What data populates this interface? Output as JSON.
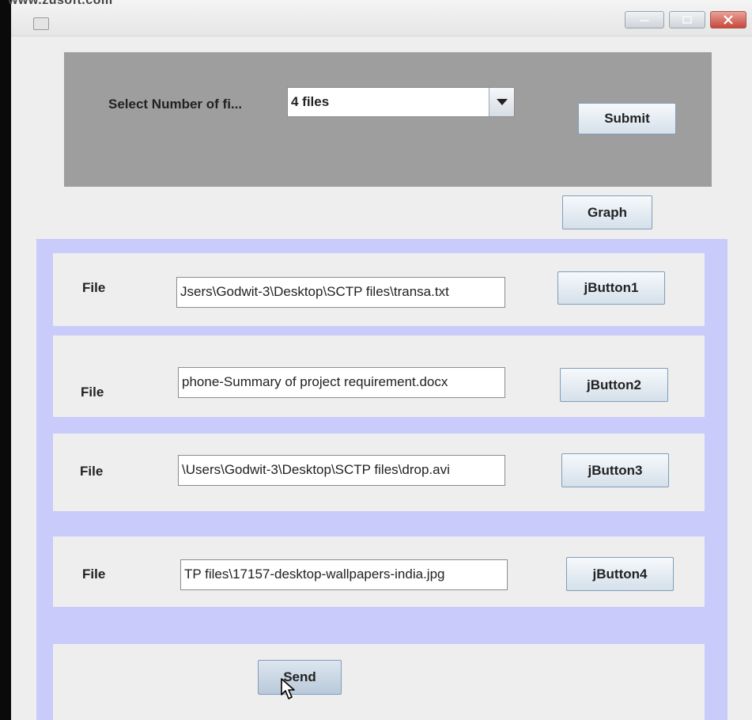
{
  "watermark": "www.zusoft.com",
  "window": {
    "title_buttons": {
      "minimize_icon": "minimize-icon",
      "maximize_icon": "maximize-icon",
      "close_icon": "close-icon"
    }
  },
  "top_panel": {
    "select_label": "Select Number of fi...",
    "combo_value": "4 files",
    "submit_label": "Submit"
  },
  "graph_label": "Graph",
  "files": [
    {
      "label": "File",
      "path": "Jsers\\Godwit-3\\Desktop\\SCTP files\\transa.txt",
      "button": "jButton1"
    },
    {
      "label": "File",
      "path": "phone-Summary of project requirement.docx",
      "button": "jButton2"
    },
    {
      "label": "File",
      "path": "\\Users\\Godwit-3\\Desktop\\SCTP files\\drop.avi",
      "button": "jButton3"
    },
    {
      "label": "File",
      "path": "TP files\\17157-desktop-wallpapers-india.jpg",
      "button": "jButton4"
    }
  ],
  "send_label": "Send",
  "colors": {
    "top_panel_bg": "#9e9e9e",
    "files_panel_bg": "#c9cbfb",
    "row_bg": "#eeeeee"
  }
}
